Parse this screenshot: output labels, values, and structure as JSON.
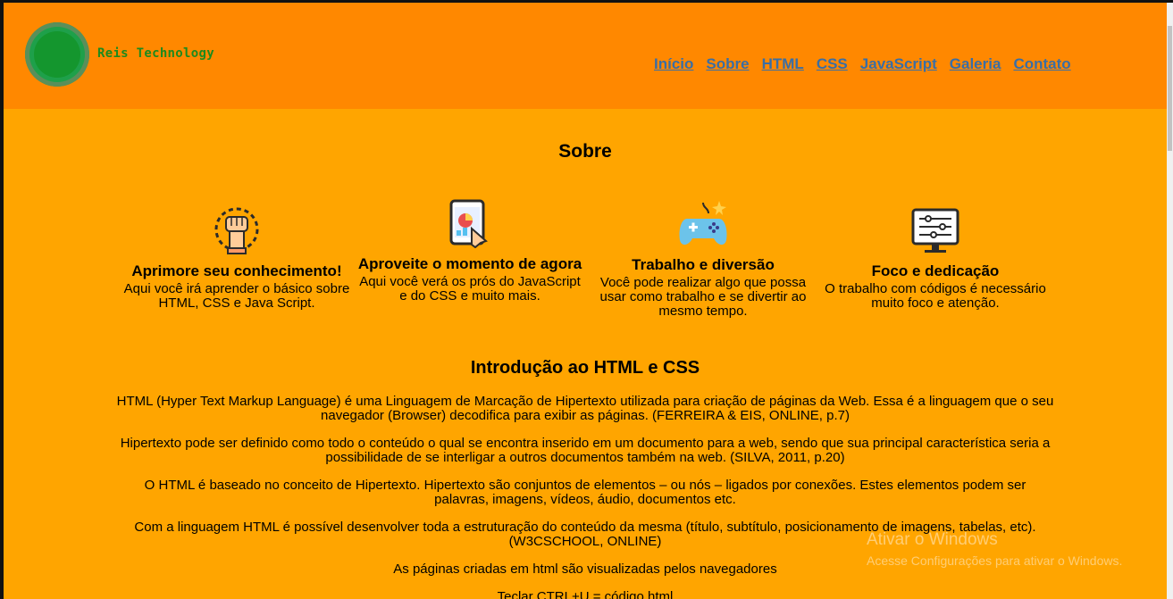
{
  "brand": {
    "name": "Reis Technology"
  },
  "nav": {
    "items": [
      "Início",
      "Sobre",
      "HTML",
      "CSS",
      "JavaScript",
      "Galeria",
      "Contato"
    ]
  },
  "about": {
    "title": "Sobre",
    "cards": [
      {
        "icon": "fist-gear-icon",
        "title": "Aprimore seu conhecimento!",
        "text": "Aqui você irá aprender o básico sobre HTML, CSS e Java Script."
      },
      {
        "icon": "tablet-chart-touch-icon",
        "title": "Aproveite o momento de agora",
        "text": "Aqui você verá os prós do JavaScript e do CSS e muito mais."
      },
      {
        "icon": "gamepad-icon",
        "title": "Trabalho e diversão",
        "text": "Você pode realizar algo que possa usar como trabalho e se divertir ao mesmo tempo."
      },
      {
        "icon": "monitor-settings-icon",
        "title": "Foco e dedicação",
        "text": "O trabalho com códigos é necessário muito foco e atenção."
      }
    ]
  },
  "intro": {
    "title": "Introdução ao HTML e CSS",
    "paragraphs": [
      "HTML (Hyper Text Markup Language) é uma Linguagem de Marcação de Hipertexto utilizada para criação de páginas da Web. Essa é a linguagem que o seu navegador (Browser) decodifica para exibir as páginas. (FERREIRA & EIS, ONLINE, p.7)",
      "Hipertexto pode ser definido como todo o conteúdo o qual se encontra inserido em um documento para a web, sendo que sua principal característica seria a possibilidade de se interligar a outros documentos também na web. (SILVA, 2011, p.20)",
      "O HTML é baseado no conceito de Hipertexto. Hipertexto são conjuntos de elementos – ou nós – ligados por conexões. Estes elementos podem ser palavras, imagens, vídeos, áudio, documentos etc.",
      "Com a linguagem HTML é possível desenvolver toda a estruturação do conteúdo da mesma (título, subtítulo, posicionamento de imagens, tabelas, etc). (W3CSCHOOL, ONLINE)",
      "As páginas criadas em html são visualizadas pelos navegadores",
      "Teclar CTRL+U = código html"
    ]
  },
  "watermark": {
    "title": "Ativar o Windows",
    "subtitle": "Acesse Configurações para ativar o Windows."
  },
  "colors": {
    "header_bg": "#ff8800",
    "page_bg": "#ffa500",
    "brand": "#1d8a1d",
    "nav_link": "#3a6ea5"
  }
}
